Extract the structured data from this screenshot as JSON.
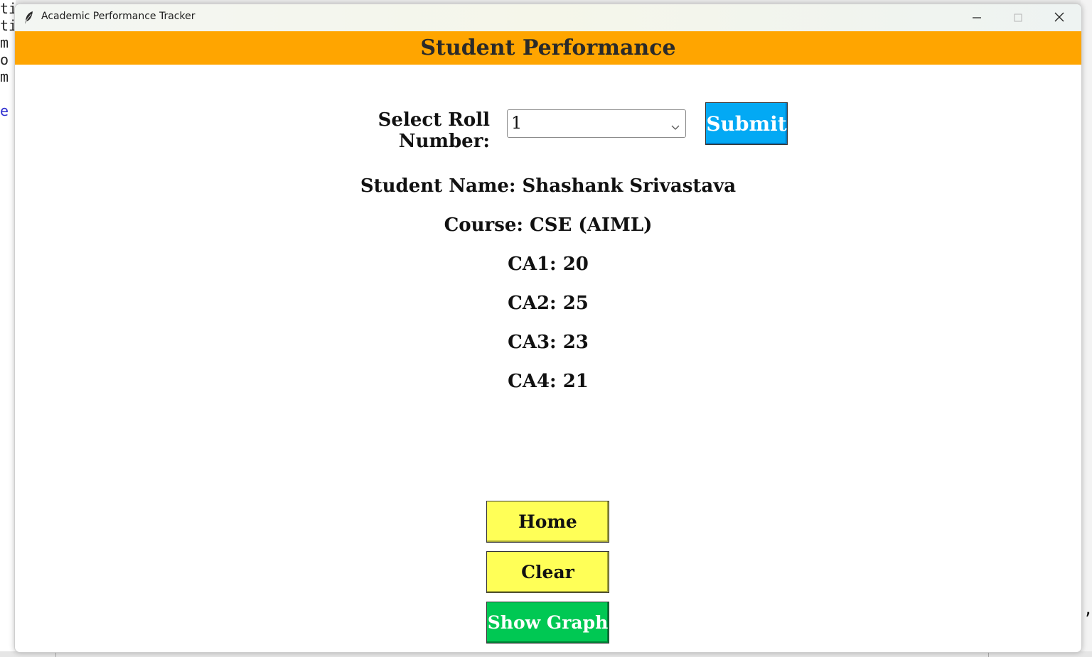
{
  "background_editor": {
    "lines": [
      "ti",
      "ti",
      "m",
      "o",
      "m",
      "",
      "e"
    ],
    "comma": ","
  },
  "window": {
    "title": "Academic Performance Tracker",
    "icon": "feather-icon",
    "controls": [
      "minimize-icon",
      "maximize-icon",
      "close-icon"
    ]
  },
  "header": {
    "title": "Student Performance",
    "color": "#ffa500"
  },
  "roll_selector": {
    "label": "Select Roll Number:",
    "selected": "1",
    "submit_label": "Submit",
    "submit_color": "#03a9f4"
  },
  "student": {
    "name_line": "Student Name: Shashank Srivastava",
    "course_line": "Course: CSE (AIML)",
    "ca1_line": "CA1: 20",
    "ca2_line": "CA2: 25",
    "ca3_line": "CA3: 23",
    "ca4_line": "CA4: 21"
  },
  "actions": {
    "home_label": "Home",
    "clear_label": "Clear",
    "graph_label": "Show Graph",
    "home_color": "#ffff57",
    "graph_color": "#00c853"
  }
}
